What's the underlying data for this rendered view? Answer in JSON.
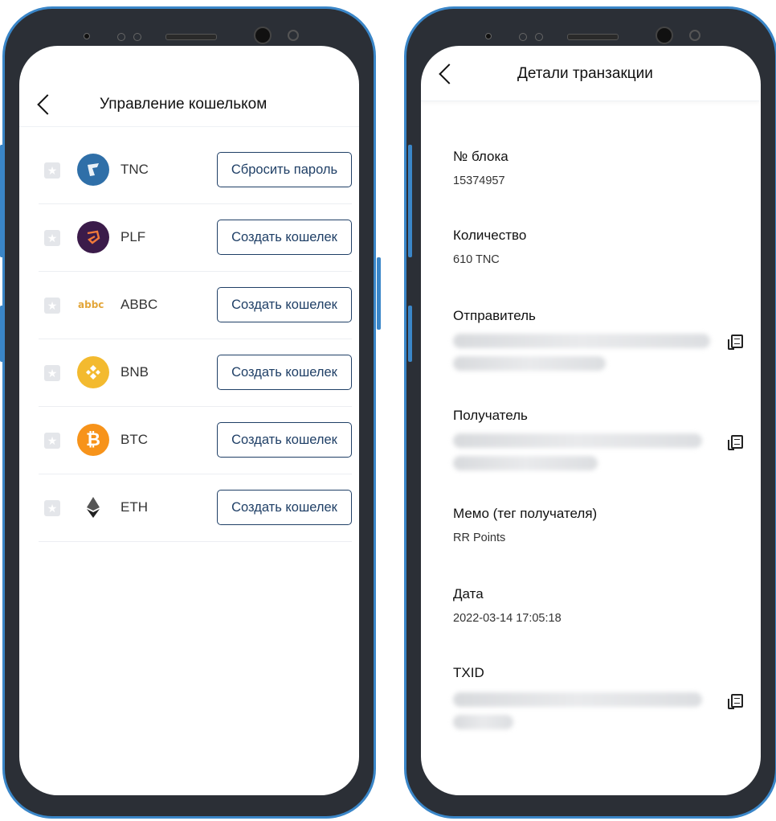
{
  "wallet_screen": {
    "title": "Управление кошельком",
    "wallets": [
      {
        "symbol": "TNC",
        "action": "Сбросить пароль",
        "icon": "tnc-coin-icon",
        "color": "#2f6fa8"
      },
      {
        "symbol": "PLF",
        "action": "Создать кошелек",
        "icon": "plf-coin-icon",
        "color": "#3b1b4a"
      },
      {
        "symbol": "ABBC",
        "action": "Создать кошелек",
        "icon": "abbc-coin-icon",
        "color": "#e3a63a"
      },
      {
        "symbol": "BNB",
        "action": "Создать кошелек",
        "icon": "bnb-coin-icon",
        "color": "#f3ba2f"
      },
      {
        "symbol": "BTC",
        "action": "Создать кошелек",
        "icon": "btc-coin-icon",
        "color": "#f7931a"
      },
      {
        "symbol": "ETH",
        "action": "Создать кошелек",
        "icon": "eth-coin-icon",
        "color": "#444444"
      }
    ]
  },
  "details_screen": {
    "title": "Детали транзакции",
    "fields": {
      "block": {
        "label": "№ блока",
        "value": "15374957"
      },
      "amount": {
        "label": "Количество",
        "value": "610 TNC"
      },
      "sender": {
        "label": "Отправитель"
      },
      "recipient": {
        "label": "Получатель"
      },
      "memo": {
        "label": "Мемо (тег получателя)",
        "value": "RR Points"
      },
      "date": {
        "label": "Дата",
        "value": "2022-03-14 17:05:18"
      },
      "txid": {
        "label": "TXID"
      }
    }
  },
  "colors": {
    "phone_frame": "#3a86c8",
    "button_border": "#1f3f66"
  }
}
